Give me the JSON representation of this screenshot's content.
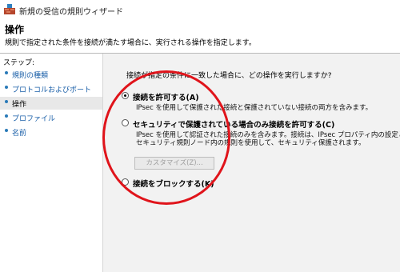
{
  "window": {
    "title": "新規の受信の規則ウィザード"
  },
  "header": {
    "title": "操作",
    "description": "規則で指定された条件を接続が満たす場合に、実行される操作を指定します。"
  },
  "sidebar": {
    "steps_label": "ステップ:",
    "items": [
      {
        "label": "規則の種類"
      },
      {
        "label": "プロトコルおよびポート"
      },
      {
        "label": "操作"
      },
      {
        "label": "プロファイル"
      },
      {
        "label": "名前"
      }
    ]
  },
  "main": {
    "question": "接続が指定の条件に一致した場合に、どの操作を実行しますか?",
    "options": [
      {
        "label": "接続を許可する(A)",
        "selected": true,
        "desc": [
          "IPsec を使用して保護された接続と保護されていない接続の両方を含みます。"
        ]
      },
      {
        "label": "セキュリティで保護されている場合のみ接続を許可する(C)",
        "selected": false,
        "desc": [
          "IPsec を使用して認証された接続のみを含みます。接続は、IPsec プロパティ内の設定と接続",
          "セキュリティ規則ノード内の規則を使用して、セキュリティ保護されます。"
        ]
      },
      {
        "label": "接続をブロックする(K)",
        "selected": false,
        "desc": []
      }
    ],
    "customize_button": "カスタマイズ(Z)..."
  },
  "colors": {
    "annotation": "#e0141b",
    "link": "#1a5fa8"
  }
}
